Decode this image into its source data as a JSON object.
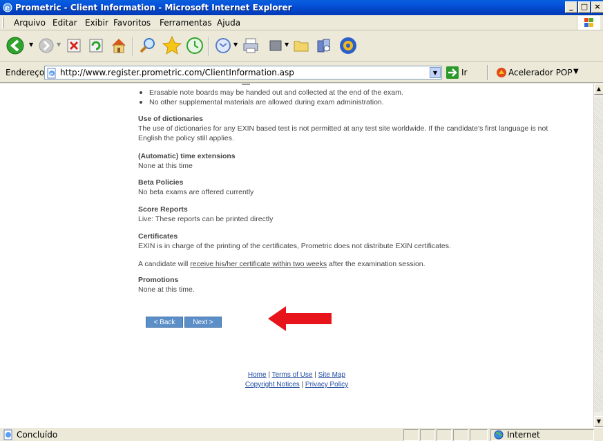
{
  "window": {
    "title": "Prometric - Client Information - Microsoft Internet Explorer",
    "minimize": "_",
    "maximize": "□",
    "close": "×"
  },
  "menu": [
    "Arquivo",
    "Editar",
    "Exibir",
    "Favoritos",
    "Ferramentas",
    "Ajuda"
  ],
  "toolbar": {
    "icons": [
      "back-icon",
      "forward-icon",
      "stop-icon",
      "refresh-icon",
      "home-icon",
      "search-icon",
      "favorites-icon",
      "history-icon",
      "mail-icon",
      "print-icon",
      "edit-icon",
      "folder-icon",
      "research-icon",
      "messenger-icon"
    ]
  },
  "address": {
    "label": "Endereço",
    "url": "http://www.register.prometric.com/ClientInformation.asp",
    "go_label": "Ir",
    "accelerator_label": "Acelerador POP"
  },
  "content": {
    "bullets": [
      "Erasable note boards may be handed out and collected at the end of the exam.",
      "No other supplemental materials are allowed during exam administration."
    ],
    "sections": [
      {
        "heading": "Use of dictionaries",
        "text": "The use of dictionaries for any EXIN based test is not permitted at any test site worldwide. If the candidate's first language is not English the policy still applies."
      },
      {
        "heading": "(Automatic) time extensions",
        "text": "None at this time"
      },
      {
        "heading": "Beta Policies",
        "text": "No beta exams are offered currently"
      },
      {
        "heading": "Score Reports",
        "text": "Live: These reports can be printed directly"
      },
      {
        "heading": "Certificates",
        "text": "EXIN is in charge of the printing of the certificates, Prometric does not distribute EXIN certificates."
      },
      {
        "heading": "Promotions",
        "text": "None at this time."
      }
    ],
    "certificate_note": {
      "before": "A candidate will ",
      "underlined": "receive his/her certificate within two weeks",
      "after": " after the examination session."
    },
    "back_button": "< Back",
    "next_button": "Next >",
    "footer": {
      "home": "Home",
      "terms": "Terms of Use",
      "sitemap": "Site Map",
      "copyright": "Copyright Notices",
      "privacy": "Privacy Policy",
      "separator": "|"
    }
  },
  "status": {
    "text": "Concluído",
    "zone": "Internet"
  },
  "colors": {
    "titlebar": "#0447c9",
    "nav_button": "#5c8fc8",
    "arrow": "#e8141b",
    "link": "#1d4aa0"
  }
}
